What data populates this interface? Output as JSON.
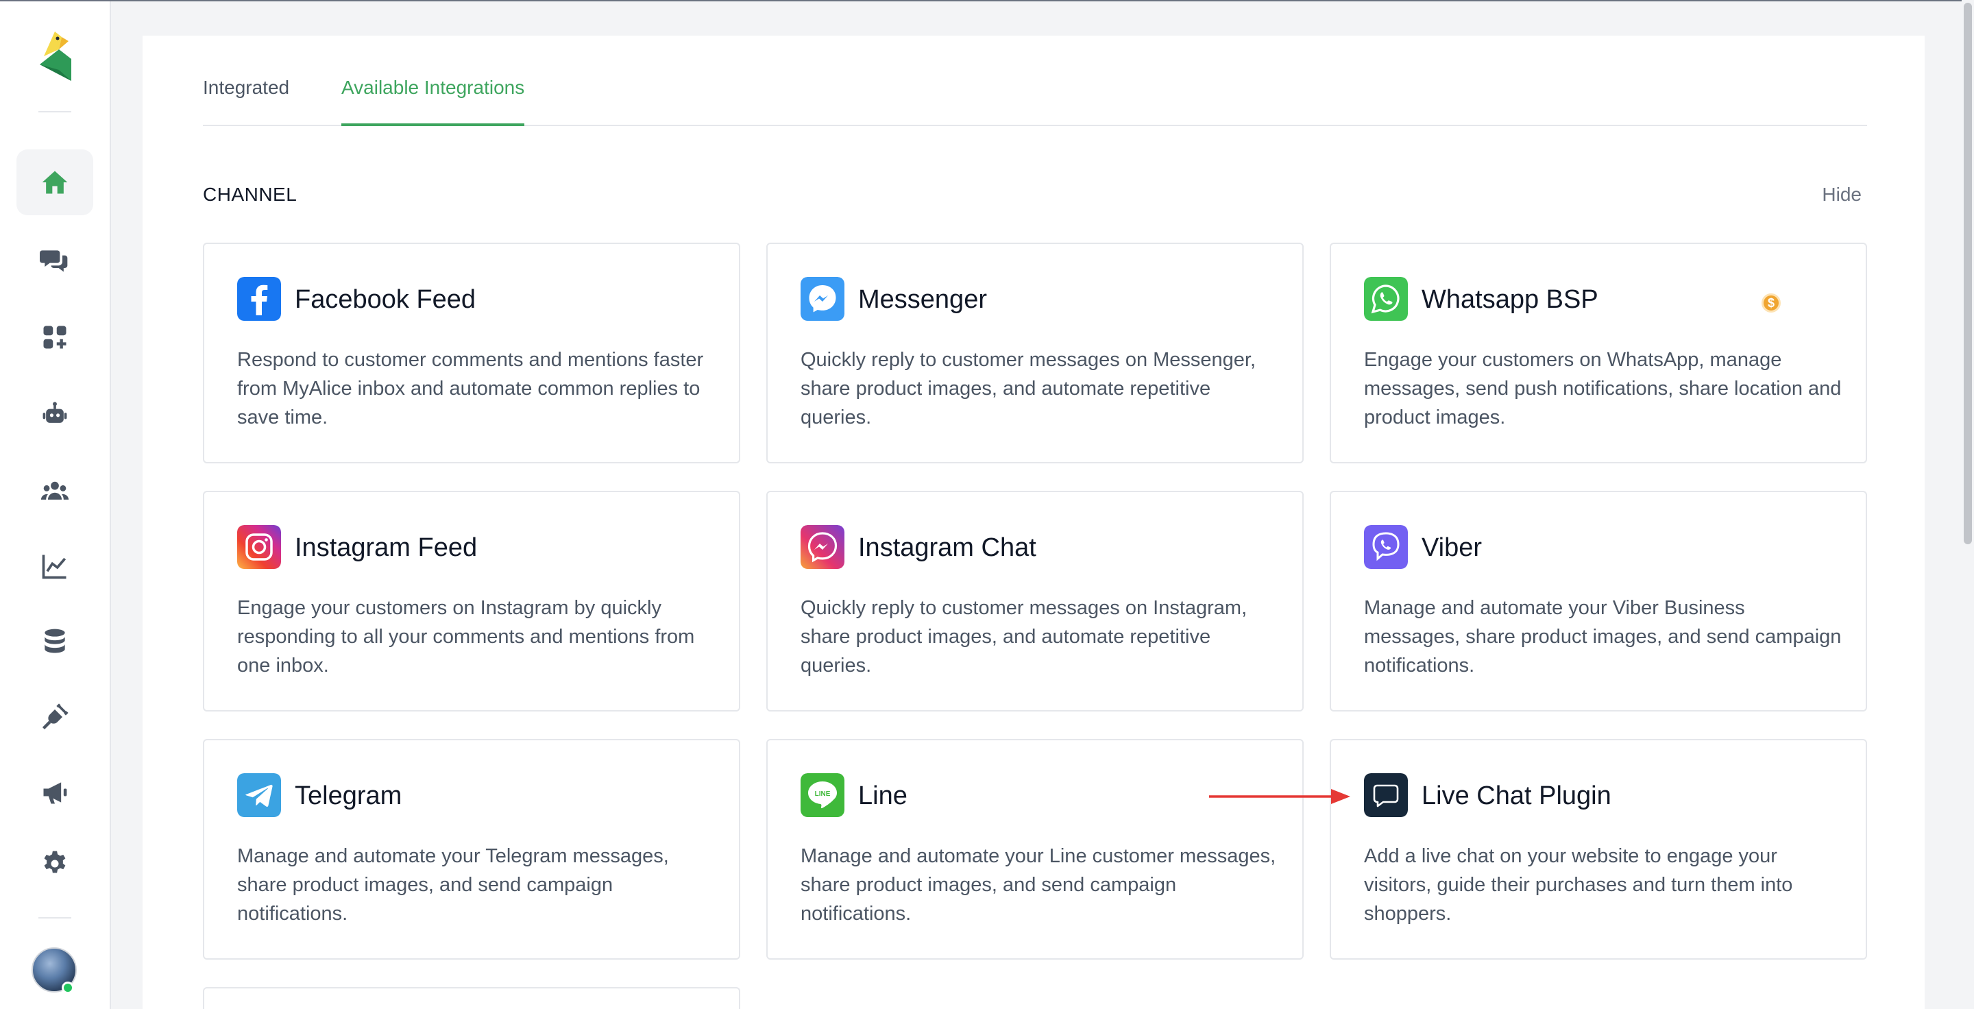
{
  "tabs": [
    {
      "label": "Integrated"
    },
    {
      "label": "Available Integrations"
    }
  ],
  "section": {
    "title": "CHANNEL",
    "hide_label": "Hide"
  },
  "cards": [
    {
      "title": "Facebook Feed",
      "desc": "Respond to customer comments and mentions faster from MyAlice inbox and automate common replies to save time.",
      "icon": "facebook-icon"
    },
    {
      "title": "Messenger",
      "desc": "Quickly reply to customer messages on Messenger, share product images, and automate repetitive queries.",
      "icon": "messenger-icon"
    },
    {
      "title": "Whatsapp BSP",
      "desc": "Engage your customers on WhatsApp, manage messages, send push notifications, share location and product images.",
      "icon": "whatsapp-icon",
      "badge": "$"
    },
    {
      "title": "Instagram Feed",
      "desc": "Engage your customers on Instagram by quickly responding to all your comments and mentions from one inbox.",
      "icon": "instagram-icon"
    },
    {
      "title": "Instagram Chat",
      "desc": "Quickly reply to customer messages on Instagram, share product images, and automate repetitive queries.",
      "icon": "instagram-chat-icon"
    },
    {
      "title": "Viber",
      "desc": "Manage and automate your Viber Business messages, share product images, and send campaign notifications.",
      "icon": "viber-icon"
    },
    {
      "title": "Telegram",
      "desc": "Manage and automate your Telegram messages, share product images, and send campaign notifications.",
      "icon": "telegram-icon"
    },
    {
      "title": "Line",
      "desc": "Manage and automate your Line customer messages, share product images, and send campaign notifications.",
      "icon": "line-icon",
      "icon_text": "LINE"
    },
    {
      "title": "Live Chat Plugin",
      "desc": "Add a live chat on your website to engage your visitors, guide their purchases and turn them into shoppers.",
      "icon": "live-chat-icon"
    }
  ],
  "sidebar": {
    "items": [
      "home-icon",
      "chats-icon",
      "integrations-icon",
      "bot-icon",
      "customers-icon",
      "analytics-icon",
      "data-icon",
      "plug-icon",
      "broadcast-icon",
      "settings-icon"
    ],
    "active": "home-icon"
  },
  "colors": {
    "accent": "#3ea55e",
    "annotation_arrow": "#e53935"
  }
}
